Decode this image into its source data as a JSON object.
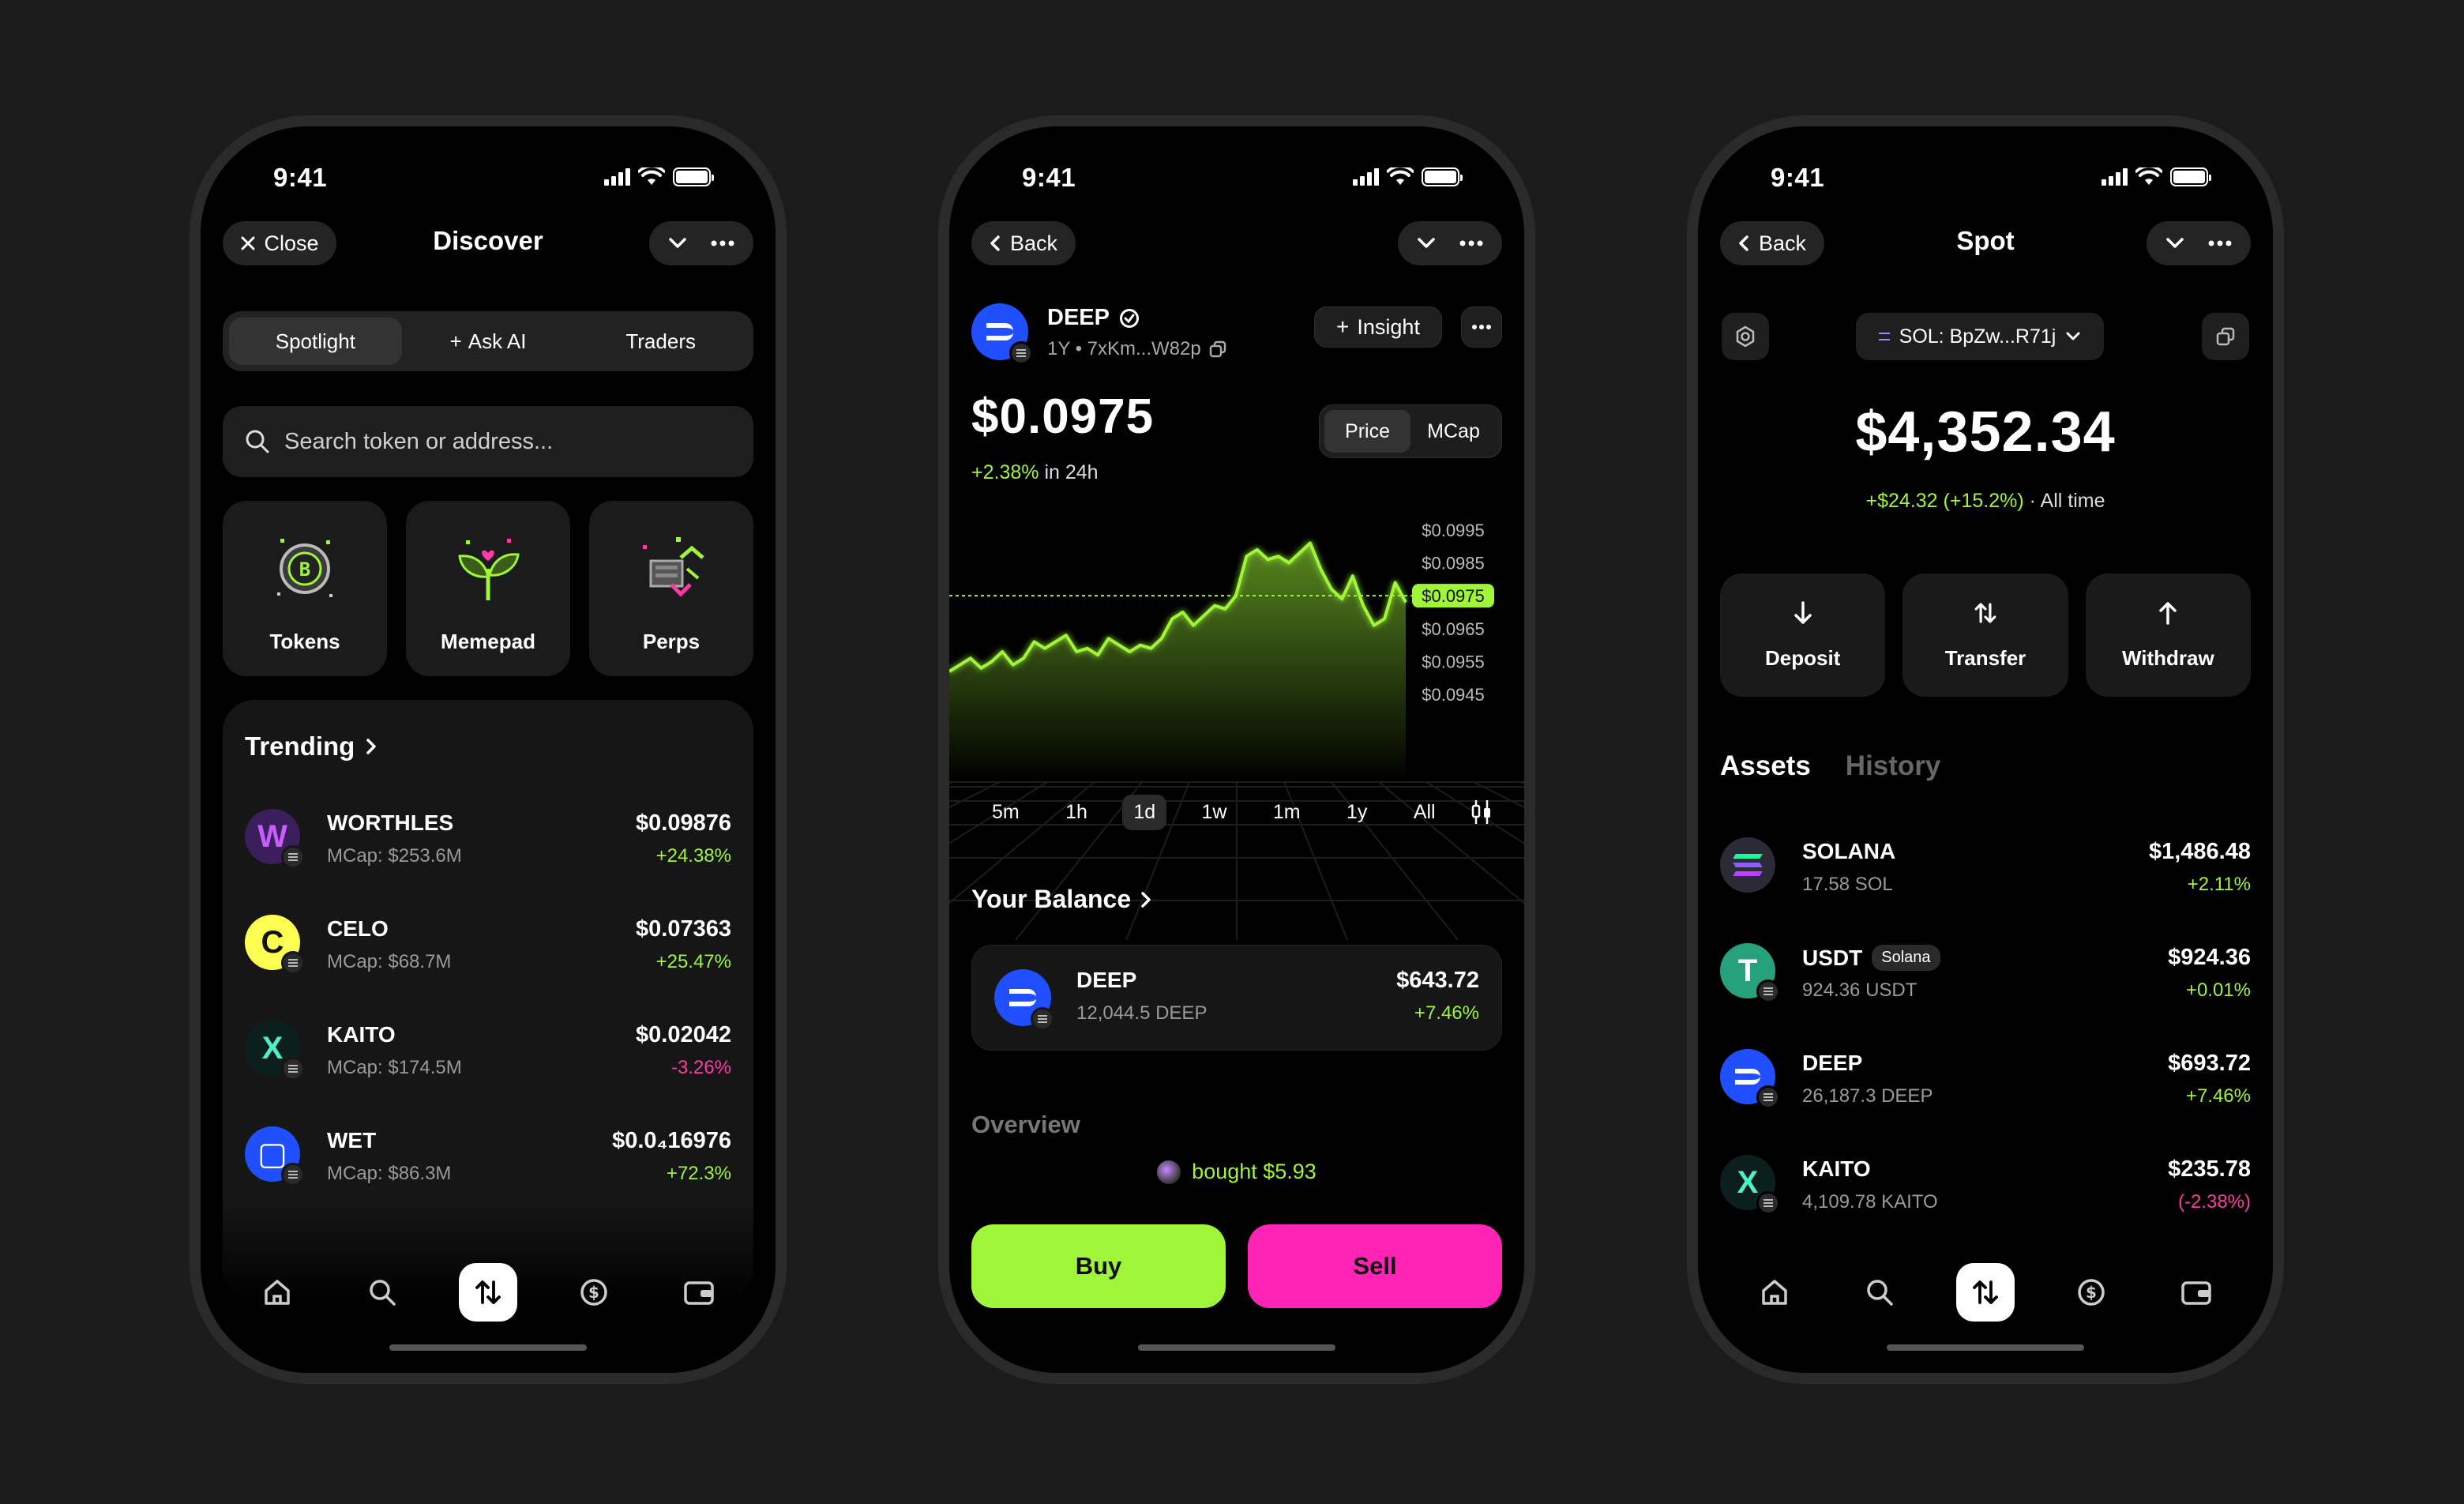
{
  "status": {
    "time": "9:41"
  },
  "discover": {
    "close_label": "Close",
    "title": "Discover",
    "segments": [
      "Spotlight",
      "Ask AI",
      "Traders"
    ],
    "search_placeholder": "Search token or address...",
    "tiles": [
      "Tokens",
      "Memepad",
      "Perps"
    ],
    "trending_title": "Trending",
    "tokens": [
      {
        "name": "WORTHLES",
        "sub": "MCap: $253.6M",
        "price": "$0.09876",
        "change": "+24.38%",
        "dir": "up",
        "color": "#3a1f5c",
        "glyph": "W",
        "glyph_color": "#c75cff"
      },
      {
        "name": "CELO",
        "sub": "MCap: $68.7M",
        "price": "$0.07363",
        "change": "+25.47%",
        "dir": "up",
        "color": "#fcff52",
        "glyph": "C",
        "glyph_color": "#111111"
      },
      {
        "name": "KAITO",
        "sub": "MCap: $174.5M",
        "price": "$0.02042",
        "change": "-3.26%",
        "dir": "down",
        "color": "#0b1f1d",
        "glyph": "X",
        "glyph_color": "#4ff0c8"
      },
      {
        "name": "WET",
        "sub": "MCap: $86.3M",
        "price": "$0.0₄16976",
        "change": "+72.3%",
        "dir": "up",
        "color": "#1f4fff",
        "glyph": "▢",
        "glyph_color": "#ffffff"
      }
    ]
  },
  "token": {
    "back_label": "Back",
    "symbol": "DEEP",
    "sub": "1Y • 7xKm...W82p",
    "insight_label": "Insight",
    "price": "$0.0975",
    "change": "+2.38%",
    "change_suffix": "in 24h",
    "toggle": [
      "Price",
      "MCap"
    ],
    "ranges": [
      "5m",
      "1h",
      "1d",
      "1w",
      "1m",
      "1y",
      "All"
    ],
    "active_range": "1d",
    "balance_title": "Your Balance",
    "balance": {
      "name": "DEEP",
      "amount": "12,044.5 DEEP",
      "value": "$643.72",
      "change": "+7.46%"
    },
    "overview_title": "Overview",
    "bought_text": "bought $5.93",
    "buy_label": "Buy",
    "sell_label": "Sell",
    "current_label": "$0.0975"
  },
  "chart_data": {
    "type": "line",
    "ylim": [
      0.094,
      0.1
    ],
    "ticks": [
      "$0.0995",
      "$0.0985",
      "$0.0975",
      "$0.0965",
      "$0.0955",
      "$0.0945"
    ],
    "tick_values": [
      0.0995,
      0.0985,
      0.0975,
      0.0965,
      0.0955,
      0.0945
    ],
    "current": 0.0975,
    "values": [
      0.0952,
      0.0954,
      0.0956,
      0.0953,
      0.0955,
      0.0958,
      0.0954,
      0.0956,
      0.0961,
      0.0959,
      0.0961,
      0.0963,
      0.0958,
      0.0959,
      0.0957,
      0.0962,
      0.096,
      0.0958,
      0.096,
      0.0959,
      0.0962,
      0.0968,
      0.097,
      0.0966,
      0.0969,
      0.0972,
      0.0971,
      0.0975,
      0.0987,
      0.0989,
      0.0986,
      0.0987,
      0.0985,
      0.0988,
      0.0991,
      0.0983,
      0.0977,
      0.0974,
      0.0981,
      0.0972,
      0.0966,
      0.0968,
      0.0979,
      0.0973
    ]
  },
  "spot": {
    "back_label": "Back",
    "title": "Spot",
    "wallet_label": "SOL: BpZw...R71j",
    "total": "$4,352.34",
    "change": "+$24.32 (+15.2%)",
    "change_suffix": "· All time",
    "actions": [
      "Deposit",
      "Transfer",
      "Withdraw"
    ],
    "tabs": [
      "Assets",
      "History"
    ],
    "assets": [
      {
        "name": "SOLANA",
        "tag": "",
        "sub": "17.58 SOL",
        "value": "$1,486.48",
        "change": "+2.11%",
        "dir": "up",
        "color": "#2b2b38"
      },
      {
        "name": "USDT",
        "tag": "Solana",
        "sub": "924.36 USDT",
        "value": "$924.36",
        "change": "+0.01%",
        "dir": "up",
        "color": "#26a17b"
      },
      {
        "name": "DEEP",
        "tag": "",
        "sub": "26,187.3 DEEP",
        "value": "$693.72",
        "change": "+7.46%",
        "dir": "up",
        "color": "#1f4fff"
      },
      {
        "name": "KAITO",
        "tag": "",
        "sub": "4,109.78 KAITO",
        "value": "$235.78",
        "change": "(-2.38%)",
        "dir": "down",
        "color": "#0b1f1d"
      }
    ]
  },
  "colors": {
    "green": "#9ff538",
    "pink": "#ff24b4",
    "bg": "#1b1b1b"
  }
}
